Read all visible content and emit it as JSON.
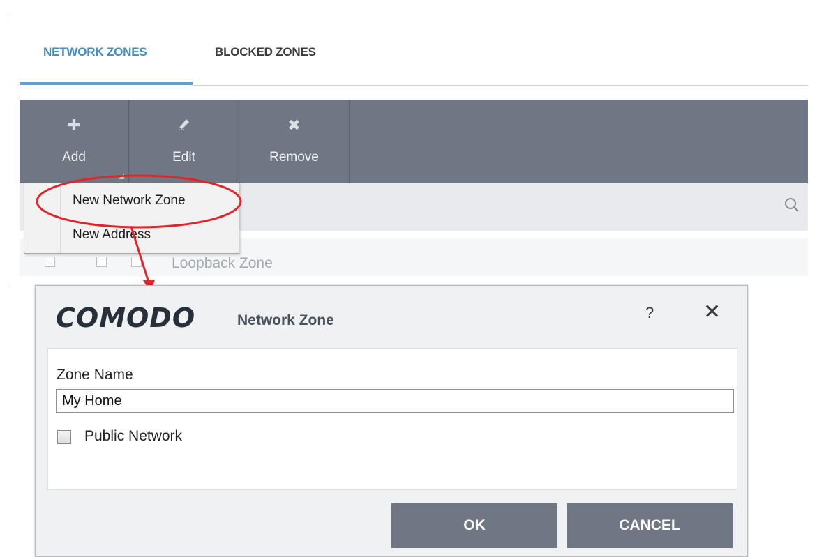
{
  "tabs": [
    {
      "label": "NETWORK ZONES",
      "active": true
    },
    {
      "label": "BLOCKED ZONES",
      "active": false
    }
  ],
  "toolbar": {
    "add_label": "Add",
    "edit_label": "Edit",
    "remove_label": "Remove",
    "icons": {
      "add": "plus-icon",
      "edit": "pencil-icon",
      "remove": "x-icon"
    }
  },
  "search": {
    "icon": "search-icon"
  },
  "add_menu": {
    "items": [
      {
        "label": "New Network Zone",
        "highlighted": true
      },
      {
        "label": "New Address",
        "highlighted": false
      }
    ]
  },
  "zone_list": {
    "rows": [
      {
        "label": "Loopback Zone"
      }
    ]
  },
  "dialog": {
    "brand": "COMODO",
    "title": "Network Zone",
    "help_glyph": "?",
    "close_glyph": "✕",
    "zone_name_label": "Zone Name",
    "zone_name_value": "My Home",
    "public_network_label": "Public Network",
    "public_network_checked": false,
    "ok_label": "OK",
    "cancel_label": "CANCEL"
  },
  "colors": {
    "accent": "#3f8cc9",
    "toolbar_bg": "#6f7684",
    "annotation": "#e0252b"
  }
}
